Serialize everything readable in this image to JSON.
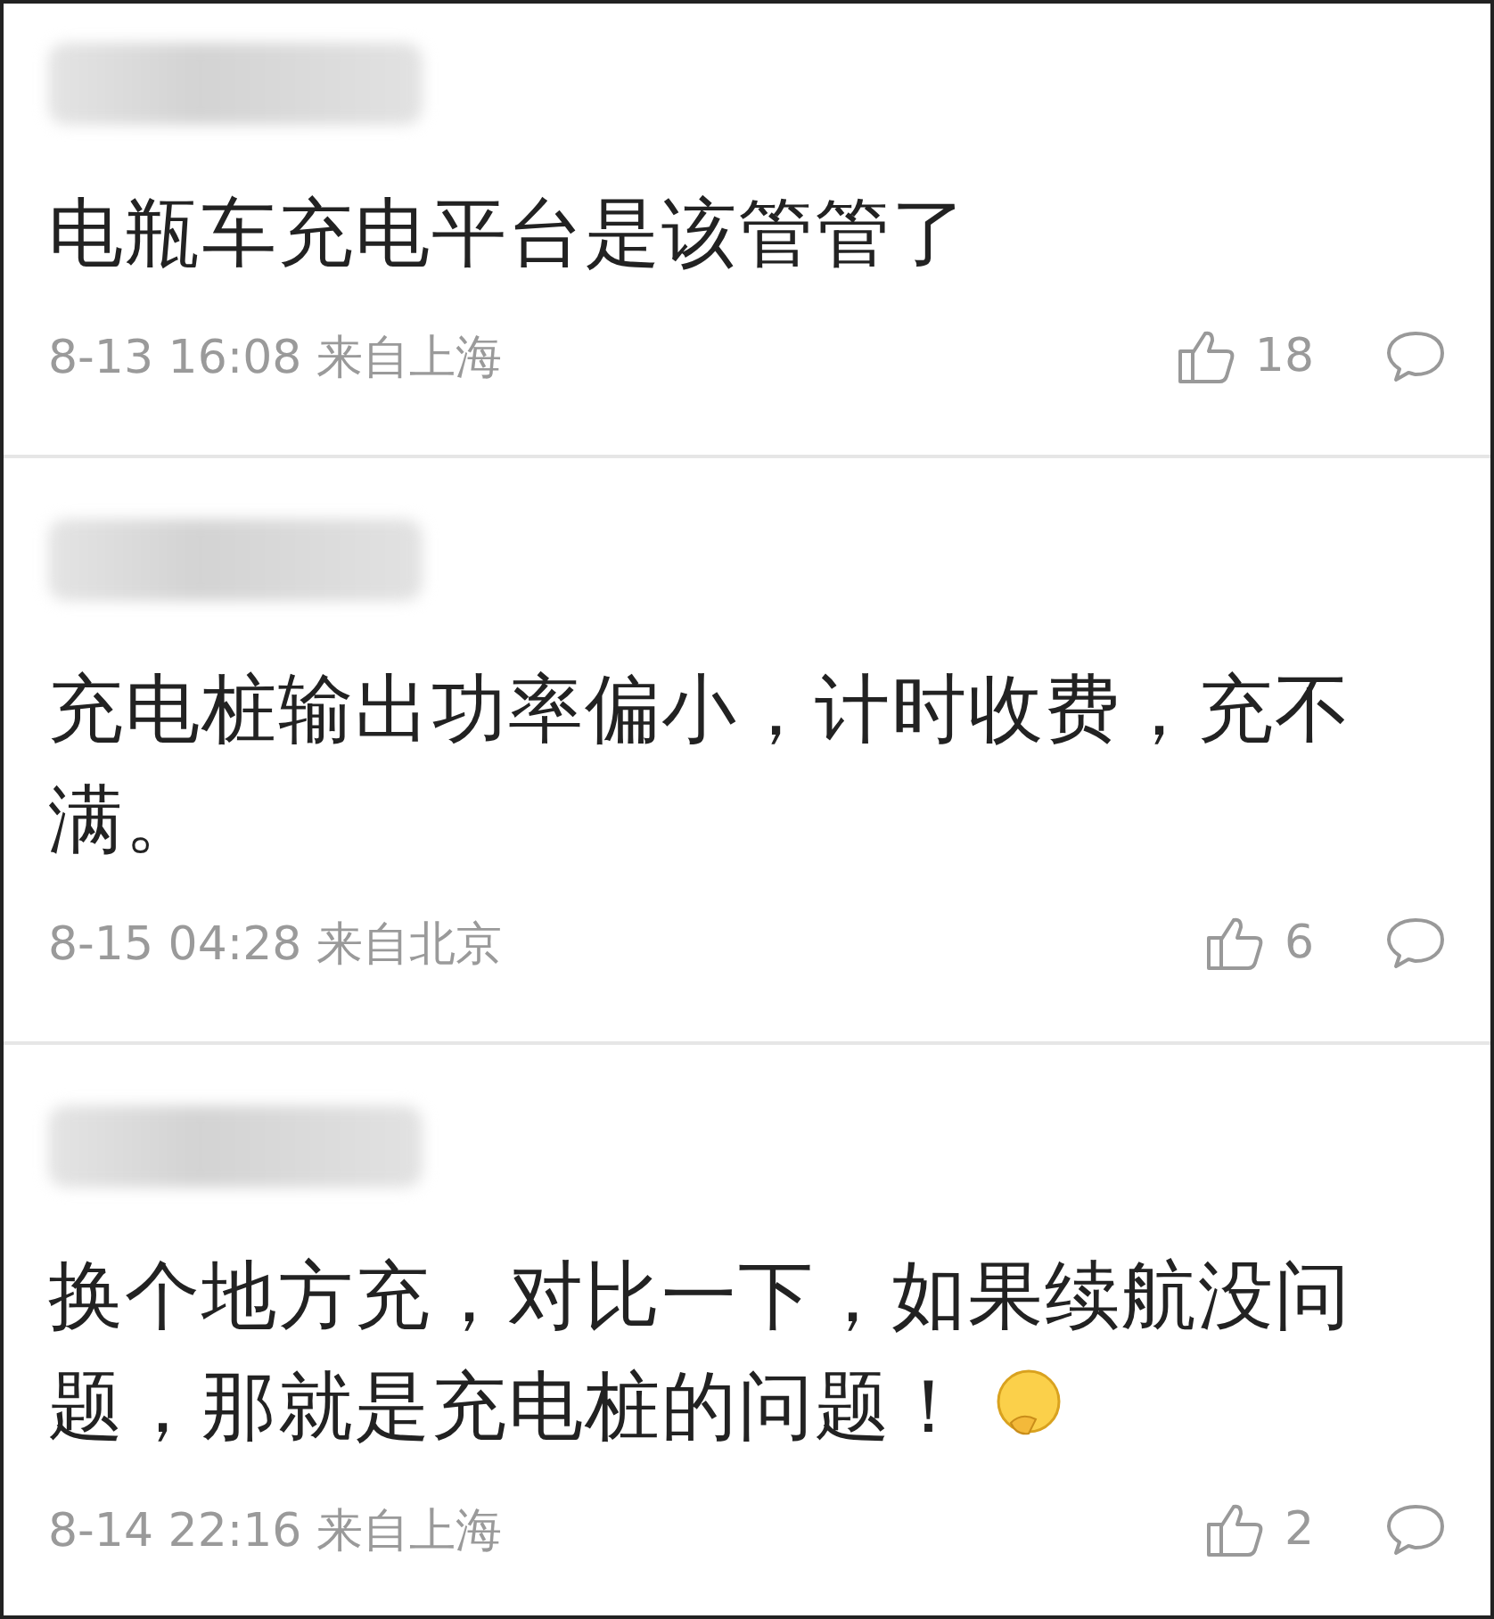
{
  "comments": [
    {
      "text": "电瓶车充电平台是该管管了",
      "time": "8-13 16:08",
      "location": "来自上海",
      "likes": "18"
    },
    {
      "text": "充电桩输出功率偏小，计时收费，充不满。",
      "time": "8-15 04:28",
      "location": "来自北京",
      "likes": "6"
    },
    {
      "text": "换个地方充，对比一下，如果续航没问题，那就是充电桩的问题！",
      "has_emoji": true,
      "time": "8-14 22:16",
      "location": "来自上海",
      "likes": "2"
    }
  ]
}
